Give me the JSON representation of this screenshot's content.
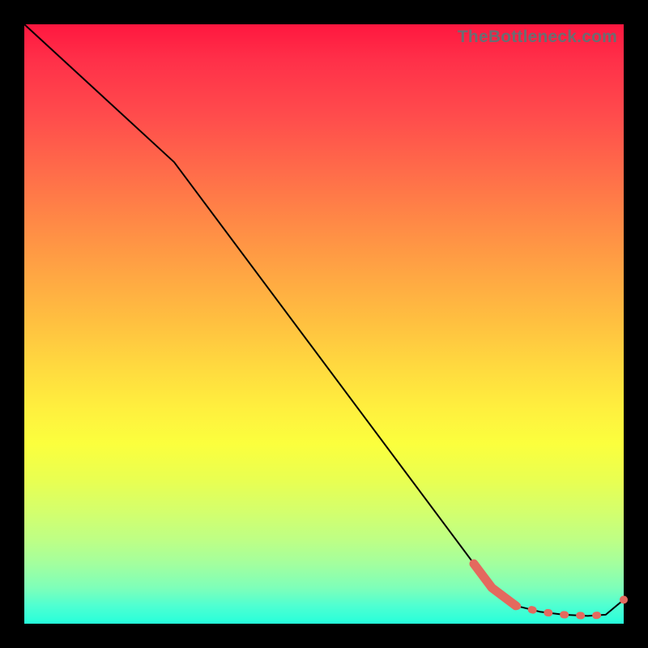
{
  "attribution": "TheBottleneck.com",
  "chart_data": {
    "type": "line",
    "title": "",
    "xlabel": "",
    "ylabel": "",
    "xlim": [
      0,
      100
    ],
    "ylim": [
      0,
      100
    ],
    "series": [
      {
        "name": "thin-black-curve",
        "style": "solid-thin",
        "color": "#000000",
        "x": [
          0,
          25,
          78,
          82,
          86,
          90,
          94,
          97,
          100
        ],
        "y": [
          100,
          77,
          6,
          3,
          2,
          1.5,
          1.3,
          1.5,
          4
        ]
      },
      {
        "name": "thick-salmon-segment",
        "style": "solid-thick",
        "color": "#e4695e",
        "x": [
          75,
          78,
          82
        ],
        "y": [
          10,
          6,
          3
        ]
      },
      {
        "name": "salmon-dashed-tail",
        "style": "dashed-thick",
        "color": "#e4695e",
        "x": [
          82,
          86,
          90,
          94,
          97
        ],
        "y": [
          3,
          2,
          1.5,
          1.3,
          1.5
        ]
      }
    ],
    "markers": [
      {
        "name": "end-marker",
        "x": 100,
        "y": 4,
        "color": "#e4695e",
        "r": 5
      }
    ]
  }
}
